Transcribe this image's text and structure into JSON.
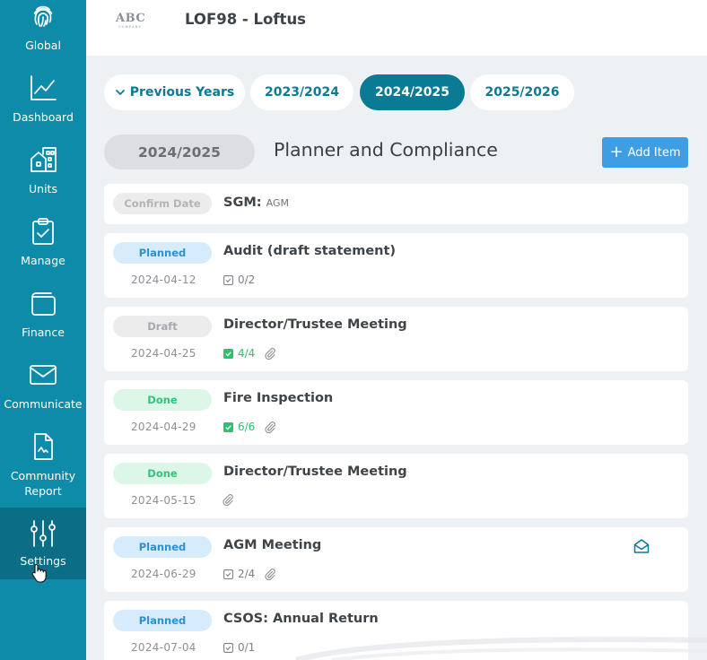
{
  "sidebar": {
    "items": [
      {
        "label": "Global",
        "icon": "fingerprint-icon"
      },
      {
        "label": "Dashboard",
        "icon": "line-chart-icon"
      },
      {
        "label": "Units",
        "icon": "buildings-icon"
      },
      {
        "label": "Manage",
        "icon": "clipboard-check-icon"
      },
      {
        "label": "Finance",
        "icon": "wallet-icon"
      },
      {
        "label": "Communicate",
        "icon": "envelope-icon"
      },
      {
        "label": "Community Report",
        "icon": "report-document-icon"
      },
      {
        "label": "Settings",
        "icon": "sliders-icon"
      }
    ],
    "active": "Settings"
  },
  "header": {
    "logo_text": "ABC",
    "logo_subtext": "COMPANY",
    "title": "LOF98 - Loftus"
  },
  "year_tabs": {
    "previous": "Previous Years",
    "tabs": [
      "2023/2024",
      "2024/2025",
      "2025/2026"
    ],
    "active": "2024/2025"
  },
  "section": {
    "year": "2024/2025",
    "title": "Planner and Compliance",
    "add_label": "Add Item"
  },
  "colors": {
    "sidebar": "#0e8ba8",
    "accent": "#0b7a95",
    "add_button": "#3f9ee3",
    "planned": "#2f8fd0",
    "done": "#35c27a"
  },
  "items": [
    {
      "status": "Confirm Date",
      "title": "SGM:",
      "subtitle": "AGM"
    },
    {
      "status": "Planned",
      "date": "2024-04-12",
      "title": "Audit (draft statement)",
      "tasks": "0/2"
    },
    {
      "status": "Draft",
      "date": "2024-04-25",
      "title": "Director/Trustee Meeting",
      "tasks": "4/4",
      "attachment": "paperclip-icon"
    },
    {
      "status": "Done",
      "date": "2024-04-29",
      "title": "Fire Inspection",
      "tasks": "6/6",
      "attachment": "paperclip-icon"
    },
    {
      "status": "Done",
      "date": "2024-05-15",
      "title": "Director/Trustee Meeting",
      "attachment": "paperclip-icon"
    },
    {
      "status": "Planned",
      "date": "2024-06-29",
      "title": "AGM Meeting",
      "tasks": "2/4",
      "attachment": "paperclip-icon",
      "action": "open-envelope-icon"
    },
    {
      "status": "Planned",
      "date": "2024-07-04",
      "title": "CSOS: Annual Return",
      "tasks": "0/1"
    }
  ]
}
